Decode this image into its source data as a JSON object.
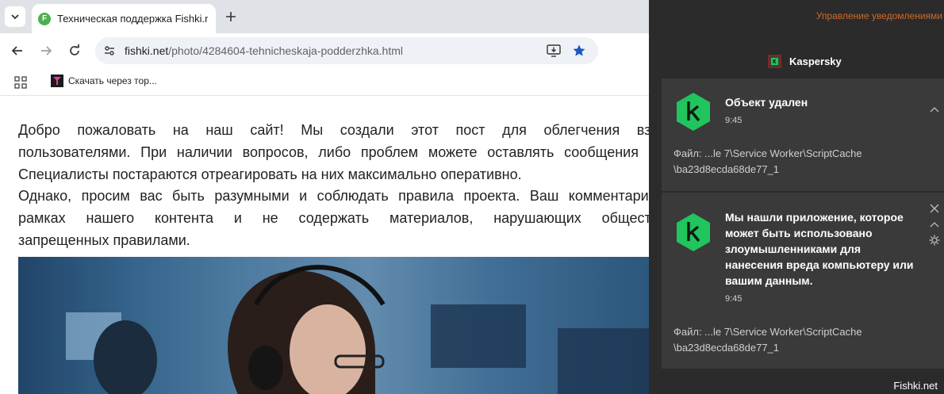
{
  "browser": {
    "tab": {
      "title": "Техническая поддержка Fishki.net",
      "favicon_letter": "F"
    },
    "address": {
      "host": "fishki.net",
      "path": "/photo/4284604-tehnicheskaja-podderzhka.html"
    },
    "bookmark": {
      "label": "Скачать через тор..."
    }
  },
  "page": {
    "paragraph1": [
      "Добро пожаловать на наш сайт! Мы создали этот пост для облегчения взаимоде",
      "пользователями. При наличии вопросов, либо проблем можете оставлять сообщения в комм",
      "Специалисты постараются отреагировать на них максимально оперативно."
    ],
    "paragraph2": [
      "Однако, просим вас быть разумными и соблюдать правила проекта. Ваш комментарий долж",
      "рамках нашего контента и не содержать материалов, нарушающих общественные",
      "запрещенных правилами."
    ]
  },
  "notifications": {
    "manage_label": "Управление уведомлениями",
    "group_name": "Kaspersky",
    "items": [
      {
        "title": "Объект удален",
        "time": "9:45",
        "file_line1": "Файл: ...le 7\\Service Worker\\ScriptCache",
        "file_line2": "\\ba23d8ecda68de77_1"
      },
      {
        "title_lines": [
          "Мы нашли приложение, которое",
          "может быть использовано",
          "злоумышленниками для",
          "нанесения вреда компьютеру или",
          "вашим данным."
        ],
        "time": "9:45",
        "file_line1": "Файл: ...le 7\\Service Worker\\ScriptCache",
        "file_line2": "\\ba23d8ecda68de77_1"
      }
    ]
  },
  "watermark": "Fishki.net",
  "colors": {
    "accent_link": "#d0692e",
    "kaspersky_green": "#21c55d",
    "panel_bg": "#2b2b2b",
    "card_bg": "#3a3a3a"
  }
}
